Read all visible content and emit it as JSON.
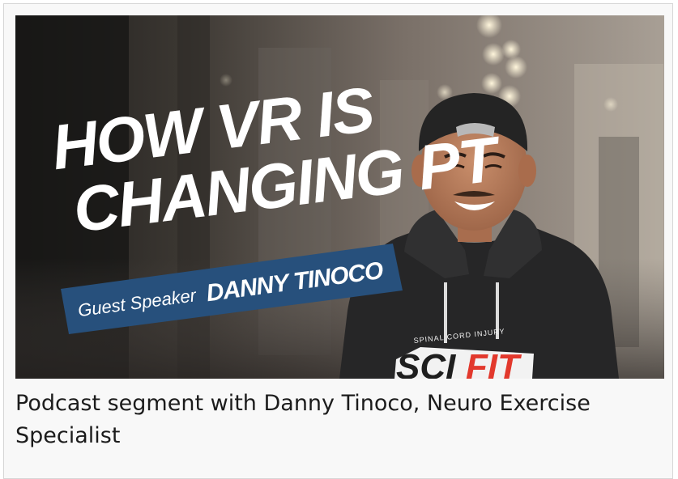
{
  "thumbnail": {
    "headline_line1": "HOW VR IS",
    "headline_line2": "CHANGING PT",
    "banner_prefix": "Guest Speaker",
    "banner_name": "DANNY TINOCO",
    "shirt_logo_top": "SPINAL CORD INJURY",
    "shirt_logo_sci": "SCI",
    "shirt_logo_fit": "FIT"
  },
  "caption": "Podcast segment with Danny Tinoco, Neuro Exercise Specialist",
  "colors": {
    "banner_blue": "#27507c",
    "logo_red": "#e2382c",
    "caption_text": "#1c1c1c",
    "card_background": "#f8f8f8"
  }
}
